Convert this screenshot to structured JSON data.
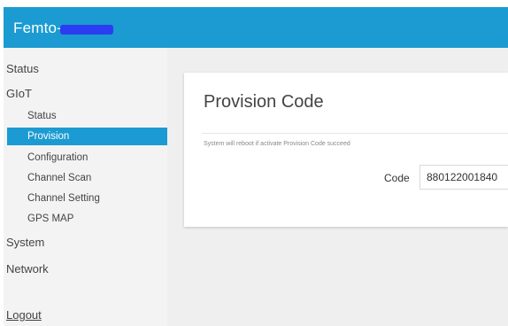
{
  "header": {
    "brand": "Femto-",
    "bg_color": "#1b9bd1"
  },
  "sidebar": {
    "items": {
      "status": "Status",
      "giot": "GIoT",
      "giot_status": "Status",
      "provision": "Provision",
      "configuration": "Configuration",
      "channel_scan": "Channel Scan",
      "channel_setting": "Channel Setting",
      "gps_map": "GPS MAP",
      "system": "System",
      "network": "Network",
      "logout": "Logout"
    },
    "active_item": "Provision",
    "active_color": "#1b9bd1"
  },
  "main": {
    "title": "Provision Code",
    "hint": "System will reboot if activate Provision Code succeed",
    "code_label": "Code",
    "code_value": "880122001840"
  }
}
